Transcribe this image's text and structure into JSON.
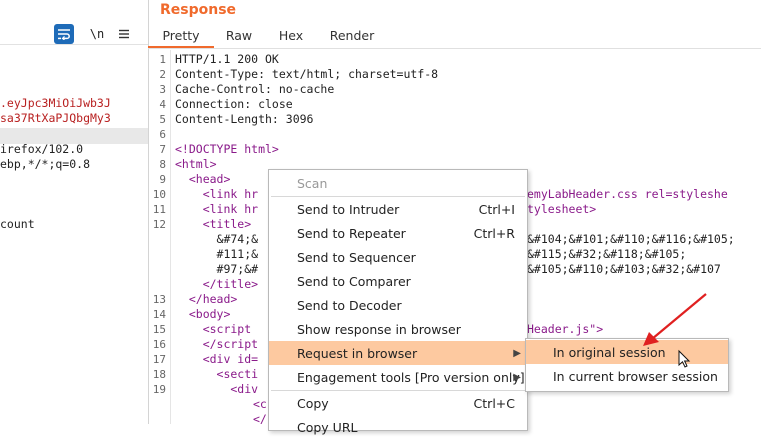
{
  "request_pane": {
    "newline_label": "\\n",
    "lines": [
      {
        "text": ".eyJpc3MiOiJwb3J",
        "color": "red"
      },
      {
        "text": "sa37RtXaPJQbgMy3",
        "color": "red"
      },
      {
        "text": "",
        "color": "dark"
      },
      {
        "text": "irefox/102.0",
        "color": "dark"
      },
      {
        "text": "ebp,*/*;q=0.8",
        "color": "dark"
      },
      {
        "text": "count",
        "color": "dark"
      }
    ]
  },
  "response": {
    "title": "Response",
    "tabs": [
      {
        "label": "Pretty",
        "active": true
      },
      {
        "label": "Raw",
        "active": false
      },
      {
        "label": "Hex",
        "active": false
      },
      {
        "label": "Render",
        "active": false
      }
    ],
    "line_numbers": [
      "1",
      "2",
      "3",
      "4",
      "5",
      "6",
      "7",
      "8",
      "9",
      "10",
      "11",
      "12",
      "",
      "",
      "",
      "",
      "13",
      "14",
      "15",
      "16",
      "17",
      "18",
      "19"
    ],
    "lines": [
      {
        "text": "HTTP/1.1 200 OK",
        "class": "dark"
      },
      {
        "text": "Content-Type: text/html; charset=utf-8",
        "class": "dark"
      },
      {
        "text": "Cache-Control: no-cache",
        "class": "dark"
      },
      {
        "text": "Connection: close",
        "class": "dark"
      },
      {
        "text": "Content-Length: 3096",
        "class": "dark"
      },
      {
        "text": "",
        "class": "dark"
      },
      {
        "text": "<!DOCTYPE html>",
        "class": "purple"
      },
      {
        "text": "<html>",
        "class": "purple"
      },
      {
        "text": "  <head>",
        "class": "purple"
      },
      {
        "text": "    <link hr",
        "class": "purple"
      },
      {
        "text": "    <link hr",
        "class": "purple"
      },
      {
        "text": "    <title>",
        "class": "purple"
      },
      {
        "text": "      &#74;&",
        "class": "dark"
      },
      {
        "text": "      #111;&",
        "class": "dark"
      },
      {
        "text": "      #97;&#",
        "class": "dark"
      },
      {
        "text": "    </title>",
        "class": "purple"
      },
      {
        "text": "  </head>",
        "class": "purple"
      },
      {
        "text": "  <body>",
        "class": "purple"
      },
      {
        "text": "    <script",
        "class": "purple"
      },
      {
        "text": "    </script",
        "class": "purple"
      },
      {
        "text": "    <div id=",
        "class": "purple"
      },
      {
        "text": "      <secti",
        "class": "purple"
      },
      {
        "text": "        <div",
        "class": "purple"
      }
    ],
    "right_fragments": [
      {
        "text": "emyLabHeader.css rel=styleshe",
        "row": 9
      },
      {
        "text": "tylesheet>",
        "row": 10
      },
      {
        "text": "&#104;&#101;&#110;&#116;&#105;",
        "row": 12
      },
      {
        "text": "&#115;&#32;&#118;&#105;",
        "row": 13
      },
      {
        "text": "&#105;&#110;&#103;&#32;&#107",
        "row": 14
      },
      {
        "text": "Header.js\">",
        "row": 18
      }
    ],
    "partial_bottom": [
      "<c",
      "</"
    ]
  },
  "context_menu": {
    "items": [
      {
        "label": "Scan",
        "shortcut": "",
        "disabled": true,
        "submenu": false
      },
      {
        "label": "Send to Intruder",
        "shortcut": "Ctrl+I",
        "disabled": false,
        "submenu": false
      },
      {
        "label": "Send to Repeater",
        "shortcut": "Ctrl+R",
        "disabled": false,
        "submenu": false
      },
      {
        "label": "Send to Sequencer",
        "shortcut": "",
        "disabled": false,
        "submenu": false
      },
      {
        "label": "Send to Comparer",
        "shortcut": "",
        "disabled": false,
        "submenu": false
      },
      {
        "label": "Send to Decoder",
        "shortcut": "",
        "disabled": false,
        "submenu": false
      },
      {
        "label": "Show response in browser",
        "shortcut": "",
        "disabled": false,
        "submenu": false
      },
      {
        "label": "Request in browser",
        "shortcut": "",
        "disabled": false,
        "submenu": true,
        "active": true
      },
      {
        "label": "Engagement tools [Pro version only]",
        "shortcut": "",
        "disabled": false,
        "submenu": true
      },
      {
        "label": "Copy",
        "shortcut": "Ctrl+C",
        "disabled": false,
        "submenu": false
      },
      {
        "label": "Copy URL",
        "shortcut": "",
        "disabled": false,
        "submenu": false
      }
    ]
  },
  "submenu": {
    "items": [
      {
        "label": "In original session",
        "active": true
      },
      {
        "label": "In current browser session",
        "active": false
      }
    ]
  },
  "colors": {
    "accent": "#f06a2c",
    "highlight": "#fdc9a0",
    "annotation_arrow": "#e02020",
    "tag": "#8a1a8a",
    "request_value": "#b82020",
    "wrap_button": "#1e6bb8"
  }
}
